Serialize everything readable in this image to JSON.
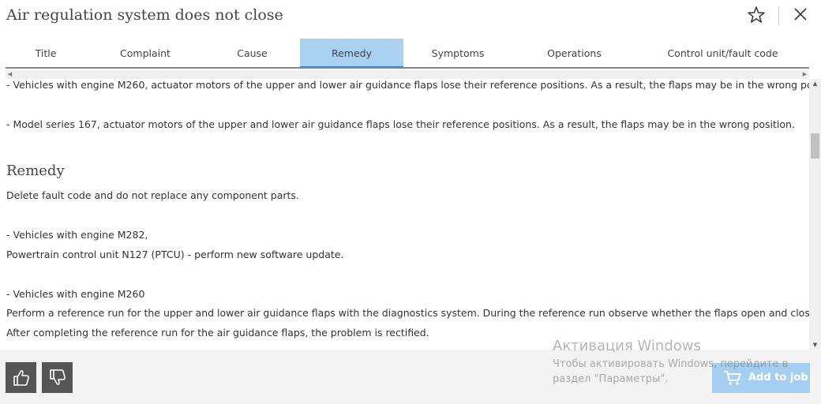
{
  "header": {
    "title": "Air regulation system does not close",
    "star_icon": "star-icon",
    "close_icon": "close-icon"
  },
  "tabs": [
    {
      "label": "Title",
      "active": false
    },
    {
      "label": "Complaint",
      "active": false
    },
    {
      "label": "Cause",
      "active": false
    },
    {
      "label": "Remedy",
      "active": true
    },
    {
      "label": "Symptoms",
      "active": false
    },
    {
      "label": "Operations",
      "active": false
    },
    {
      "label": "Control unit/fault code",
      "active": false
    }
  ],
  "content": {
    "cause_line_1": "- Vehicles with engine M260, actuator motors of the upper and lower air guidance flaps lose their reference positions. As a result, the flaps may be in the wrong position.",
    "cause_line_2": "- Model series 167, actuator motors of the upper and lower air guidance flaps lose their reference positions. As a result, the flaps may be in the wrong position.",
    "remedy_heading": "Remedy",
    "remedy_line_1": "Delete fault code and do not replace any component parts.",
    "remedy_line_2": "- Vehicles with engine M282,",
    "remedy_line_3": "Powertrain control unit N127 (PTCU) - perform new software update.",
    "remedy_line_4": "- Vehicles with engine M260",
    "remedy_line_5": "Perform a reference run for the upper and lower air guidance flaps with the diagnostics system. During the reference run observe whether the flaps open and close fully.",
    "remedy_line_6": "After completing the reference run for the air guidance flaps, the problem is rectified."
  },
  "footer": {
    "thumbs_up_icon": "thumbs-up-icon",
    "thumbs_down_icon": "thumbs-down-icon",
    "add_to_job_label": "Add to job",
    "cart_icon": "cart-icon"
  },
  "watermark": {
    "title": "Активация Windows",
    "line_1": "Чтобы активировать Windows, перейдите в",
    "line_2": "раздел \"Параметры\"."
  },
  "colors": {
    "active_tab_bg": "#aad1f0",
    "active_tab_underline": "#1e7fcf",
    "add_to_job_bg": "#a4cff3",
    "footer_button_bg": "#555555"
  }
}
